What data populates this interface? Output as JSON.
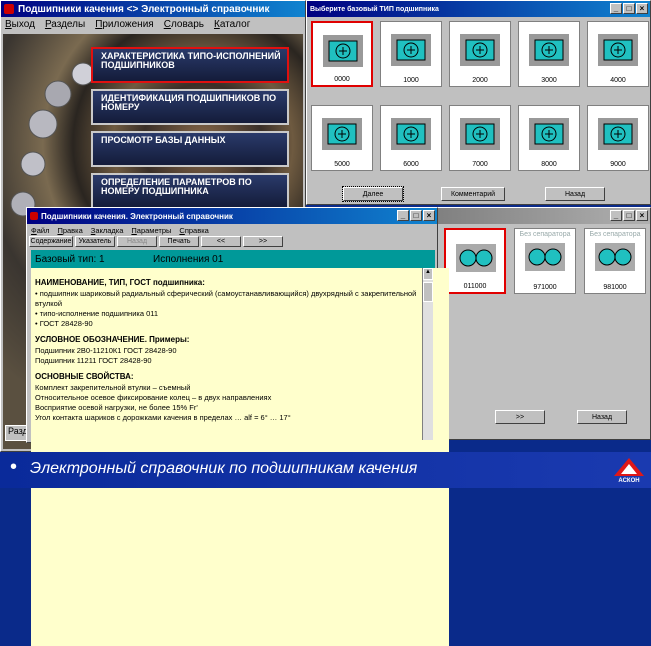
{
  "main_window": {
    "title": "Подшипники качения <> Электронный справочник",
    "menu": [
      "Выход",
      "Разделы",
      "Приложения",
      "Словарь",
      "Каталог"
    ],
    "nav_buttons": [
      "Характеристика типо-исполнений подшипников",
      "Идентификация подшипников по номеру",
      "Просмотр базы данных",
      "Определение параметров по номеру подшипника"
    ],
    "status_text": "Разд"
  },
  "type_window": {
    "title": "Выберите базовый ТИП подшипника",
    "tiles": [
      "0000",
      "1000",
      "2000",
      "3000",
      "4000",
      "5000",
      "6000",
      "7000",
      "8000",
      "9000"
    ],
    "buttons": [
      "Далее",
      "Комментарий",
      "Назад"
    ]
  },
  "variants_window": {
    "tiles": [
      {
        "code": "011000",
        "label": ""
      },
      {
        "code": "971000",
        "label": "Без сепаратора"
      },
      {
        "code": "981000",
        "label": "Без сепаратора"
      }
    ],
    "buttons": [
      ">>",
      "Назад"
    ]
  },
  "help_window": {
    "title": "Подшипники качения. Электронный справочник",
    "menu": [
      "Файл",
      "Правка",
      "Закладка",
      "Параметры",
      "Справка"
    ],
    "toolbar": [
      "Содержание",
      "Указатель",
      "Назад",
      "Печать",
      "<<",
      ">>"
    ],
    "header_left": "Базовый тип:  1",
    "header_right": "Исполнения 01",
    "sections": [
      {
        "heading": "НАИМЕНОВАНИЕ, ТИП, ГОСТ подшипника:",
        "lines": [
          "• подшипник шариковый радиальный сферический (самоустанавливающийся) двухрядный с закрепительной втулкой",
          "• типо-исполнение подшипника 011",
          "• ГОСТ 28428-90"
        ]
      },
      {
        "heading": "УСЛОВНОЕ ОБОЗНАЧЕНИЕ. Примеры:",
        "lines": [
          "Подшипник 2В0-11210К1 ГОСТ 28428-90",
          "Подшипник 11211 ГОСТ 28428-90"
        ]
      },
      {
        "heading": "ОСНОВНЫЕ СВОЙСТВА:",
        "lines": [
          "Комплект закрепительной втулки – съемный",
          "Относительное осевое фиксирование колец – в двух направлениях",
          "Восприятие осевой нагрузки, не более 15% Fr'",
          "Угол контакта шариков с дорожками качения в пределах … alf = 6° … 17°"
        ]
      }
    ]
  },
  "footer": {
    "bullet": "•",
    "caption": "Электронный справочник по подшипникам качения",
    "logo_text": "АСКОН"
  },
  "colors": {
    "accent_red": "#e00000",
    "title_blue": "#000080",
    "help_teal": "#009999",
    "content_yellow": "#ffffcc",
    "footer_blue": "#0a2a9a"
  }
}
